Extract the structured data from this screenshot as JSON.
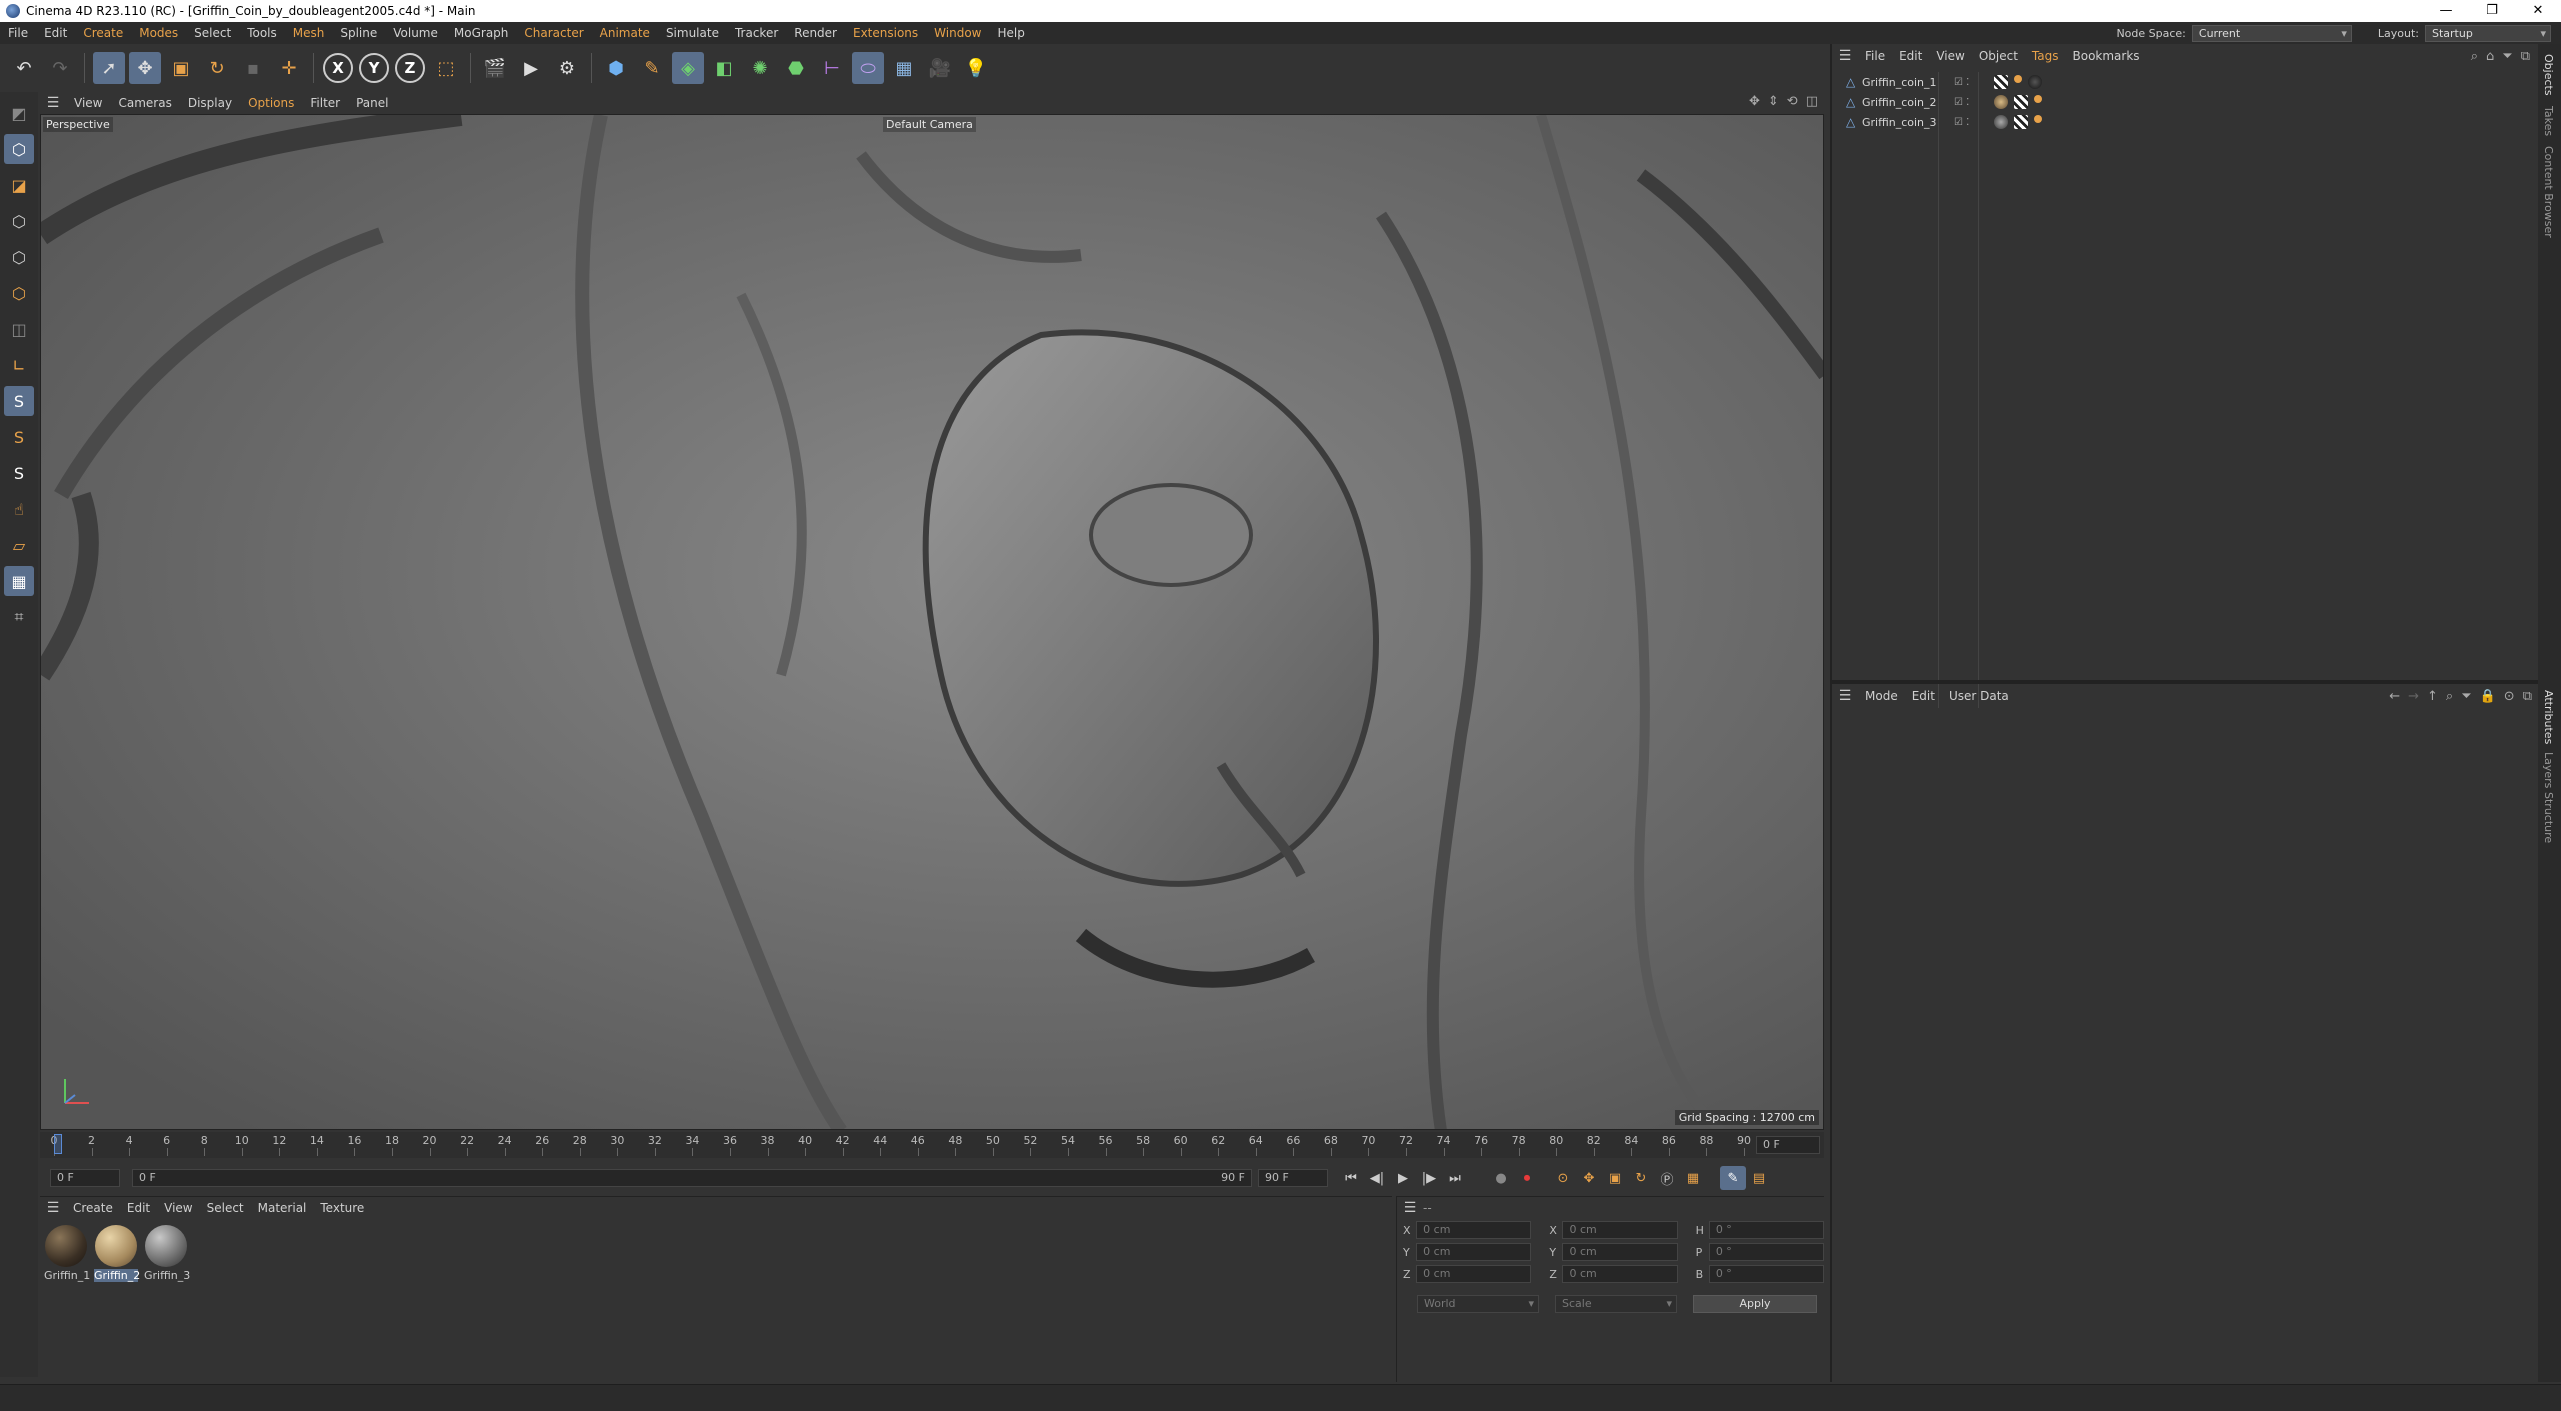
{
  "window": {
    "title": "Cinema 4D R23.110 (RC) - [Griffin_Coin_by_doubleagent2005.c4d *] - Main",
    "controls": [
      "—",
      "❐",
      "✕"
    ]
  },
  "menubar": {
    "items": [
      "File",
      "Edit",
      "Create",
      "Modes",
      "Select",
      "Tools",
      "Mesh",
      "Spline",
      "Volume",
      "MoGraph",
      "Character",
      "Animate",
      "Simulate",
      "Tracker",
      "Render",
      "Extensions",
      "Window",
      "Help"
    ],
    "node_space_label": "Node Space:",
    "node_space_value": "Current (Standard/Physical)",
    "layout_label": "Layout:",
    "layout_value": "Startup"
  },
  "viewport": {
    "menu": [
      "View",
      "Cameras",
      "Display",
      "Options",
      "Filter",
      "Panel"
    ],
    "projection": "Perspective",
    "camera": "Default Camera",
    "grid_spacing": "Grid Spacing : 12700 cm"
  },
  "timeline": {
    "ticks": [
      "0",
      "2",
      "4",
      "6",
      "8",
      "10",
      "12",
      "14",
      "16",
      "18",
      "20",
      "22",
      "24",
      "26",
      "28",
      "30",
      "32",
      "34",
      "36",
      "38",
      "40",
      "42",
      "44",
      "46",
      "48",
      "50",
      "52",
      "54",
      "56",
      "58",
      "60",
      "62",
      "64",
      "66",
      "68",
      "70",
      "72",
      "74",
      "76",
      "78",
      "80",
      "82",
      "84",
      "86",
      "88",
      "90"
    ],
    "current_frame": "0 F",
    "start_field": "0 F",
    "range_start": "0 F",
    "range_end": "90 F",
    "end_field": "90 F"
  },
  "materials": {
    "menu": [
      "Create",
      "Edit",
      "View",
      "Select",
      "Material",
      "Texture"
    ],
    "items": [
      {
        "name": "Griffin_1",
        "color": "#3a2f24"
      },
      {
        "name": "Griffin_2",
        "color": "#a68a5e"
      },
      {
        "name": "Griffin_3",
        "color": "#6b6b6b"
      }
    ],
    "selected": "Griffin_2"
  },
  "coordinates": {
    "header": "--",
    "rows": [
      {
        "a": "X",
        "av": "0 cm",
        "b": "X",
        "bv": "0 cm",
        "c": "H",
        "cv": "0 °"
      },
      {
        "a": "Y",
        "av": "0 cm",
        "b": "Y",
        "bv": "0 cm",
        "c": "P",
        "cv": "0 °"
      },
      {
        "a": "Z",
        "av": "0 cm",
        "b": "Z",
        "bv": "0 cm",
        "c": "B",
        "cv": "0 °"
      }
    ],
    "world": "World",
    "scale": "Scale",
    "apply": "Apply"
  },
  "objects_panel": {
    "menu": [
      "File",
      "Edit",
      "View",
      "Object",
      "Tags",
      "Bookmarks"
    ],
    "objects": [
      "Griffin_coin_1",
      "Griffin_coin_2",
      "Griffin_coin_3"
    ]
  },
  "attributes_panel": {
    "menu": [
      "Mode",
      "Edit",
      "User Data"
    ]
  },
  "side_tabs": [
    "Objects",
    "Takes",
    "Content Browser",
    "Attributes",
    "Layers",
    "Structure"
  ],
  "colors": {
    "accent": "#e8a24a",
    "selection": "#5a6f8c",
    "background": "#333333"
  }
}
